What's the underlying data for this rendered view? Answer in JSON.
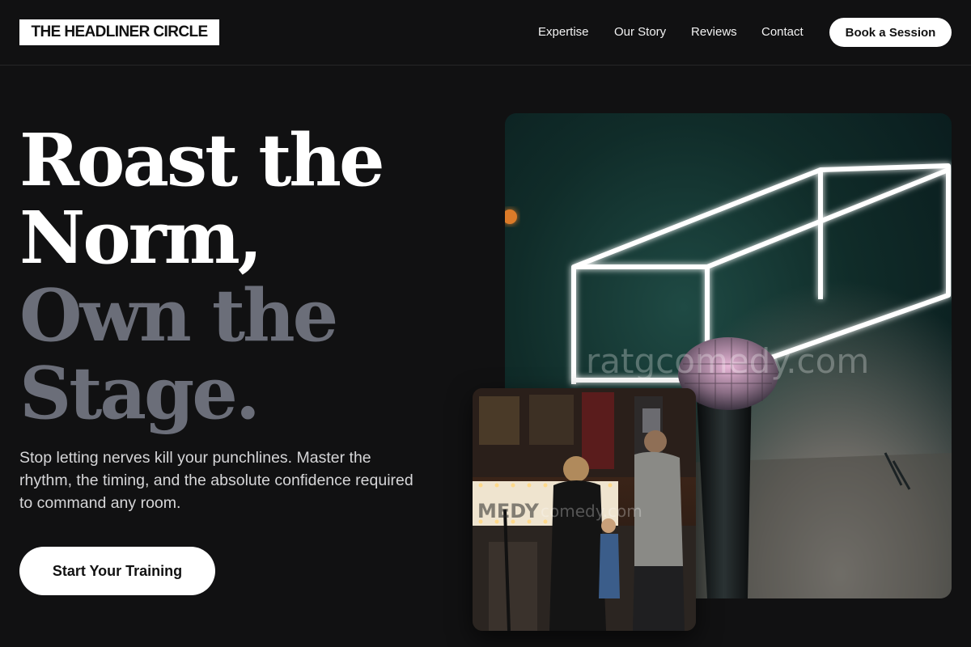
{
  "brand": {
    "logo_text": "THE HEADLINER CIRCLE"
  },
  "nav": {
    "links": [
      "Expertise",
      "Our Story",
      "Reviews",
      "Contact"
    ],
    "cta_label": "Book a Session"
  },
  "hero": {
    "headline_line1": "Roast the",
    "headline_line2": "Norm,",
    "headline_line3": "Own the",
    "headline_line4": "Stage.",
    "subtext": "Stop letting nerves kill your punchlines. Master the rhythm, the timing, and the absolute confidence required to command any room.",
    "cta_label": "Start Your Training"
  },
  "images": {
    "main": {
      "watermark": "ratgcomedy.com"
    },
    "secondary": {
      "marquee": "MEDY",
      "watermark": "comedy.com"
    }
  },
  "colors": {
    "background": "#111112",
    "headline_white": "#ffffff",
    "headline_grey": "#6b6e79",
    "button_bg": "#ffffff"
  }
}
